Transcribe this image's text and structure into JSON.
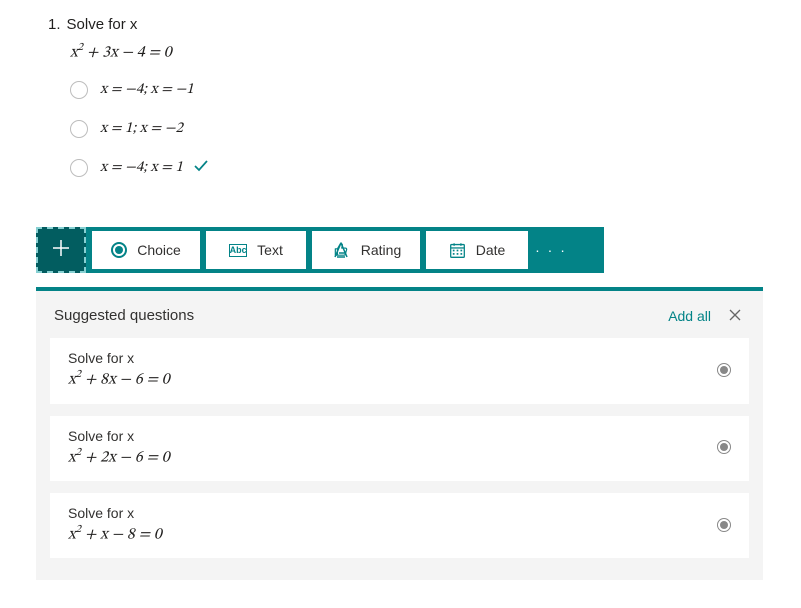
{
  "question": {
    "number": "1.",
    "title": "Solve for x",
    "equation_html": "<i>x</i><sup>2</sup> + 3<i>x</i> − 4 = 0",
    "options": [
      {
        "text_html": "<i>x</i> = −4; <i>x</i> = −1",
        "correct": false
      },
      {
        "text_html": "<i>x</i> = 1; <i>x</i> = −2",
        "correct": false
      },
      {
        "text_html": "<i>x</i> = −4; <i>x</i> = 1",
        "correct": true
      }
    ]
  },
  "toolbar": {
    "choice_label": "Choice",
    "text_label": "Text",
    "text_icon_label": "Abc",
    "rating_label": "Rating",
    "date_label": "Date"
  },
  "suggestions": {
    "header": "Suggested questions",
    "add_all_label": "Add all",
    "items": [
      {
        "title": "Solve for x",
        "equation_html": "<i>x</i><sup>2</sup> + 8<i>x</i> − 6 = 0"
      },
      {
        "title": "Solve for x",
        "equation_html": "<i>x</i><sup>2</sup> + 2<i>x</i> − 6 = 0"
      },
      {
        "title": "Solve for x",
        "equation_html": "<i>x</i><sup>2</sup> + <i>x</i> − 8 = 0"
      }
    ]
  },
  "colors": {
    "teal": "#038387"
  }
}
